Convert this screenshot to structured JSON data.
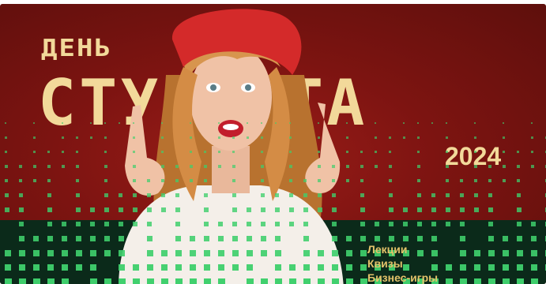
{
  "banner": {
    "title_small": "ДЕНЬ",
    "title_large": "СТУДЕНТА",
    "year": "2024",
    "features": [
      "Лекции",
      "Квизы",
      "Бизнес-игры"
    ]
  },
  "illustration": {
    "subject": "person-photo",
    "hat_color": "#d42a2a",
    "hair_color": "#d7954e"
  },
  "colors": {
    "background": "#7d1411",
    "title": "#f2d99a",
    "features": "#e3c26a",
    "band": "#0b2a1a",
    "pixel_dots": "#3fcf6c"
  }
}
